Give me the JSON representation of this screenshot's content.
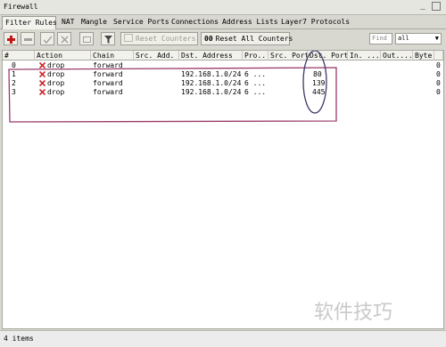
{
  "window": {
    "title": "Firewall",
    "minimize_glyph": "_",
    "maximize_glyph": ""
  },
  "tabs": [
    {
      "label": "Filter Rules",
      "active": true
    },
    {
      "label": "NAT",
      "active": false
    },
    {
      "label": "Mangle",
      "active": false
    },
    {
      "label": "Service Ports",
      "active": false
    },
    {
      "label": "Connections",
      "active": false
    },
    {
      "label": "Address Lists",
      "active": false
    },
    {
      "label": "Layer7 Protocols",
      "active": false
    }
  ],
  "toolbar": {
    "reset_counters_label": "Reset Counters",
    "reset_all_counters_label": "Reset All Counters",
    "reset_all_counters_prefix": "00",
    "find_placeholder": "Find",
    "filter_value": "all",
    "icons": [
      "plus-icon",
      "minus-icon",
      "check-icon",
      "cross-icon",
      "comment-icon",
      "filter-icon"
    ]
  },
  "table": {
    "columns": [
      "#",
      "Action",
      "Chain",
      "Src. Add.",
      "Dst. Address",
      "Pro...",
      "Src. Port",
      "Dst. Port",
      "In. ...",
      "Out....",
      "Byte",
      ""
    ],
    "rows": [
      {
        "num": "0",
        "action": "drop",
        "chain": "forward",
        "src_add": "",
        "dst_address": "",
        "proto": "",
        "src_port": "",
        "dst_port": "",
        "in": "",
        "out": "",
        "bytes": "0"
      },
      {
        "num": "1",
        "action": "drop",
        "chain": "forward",
        "src_add": "",
        "dst_address": "192.168.1.0/24",
        "proto": "6 ...",
        "src_port": "",
        "dst_port": "80",
        "in": "",
        "out": "",
        "bytes": "0"
      },
      {
        "num": "2",
        "action": "drop",
        "chain": "forward",
        "src_add": "",
        "dst_address": "192.168.1.0/24",
        "proto": "6 ...",
        "src_port": "",
        "dst_port": "139",
        "in": "",
        "out": "",
        "bytes": "0"
      },
      {
        "num": "3",
        "action": "drop",
        "chain": "forward",
        "src_add": "",
        "dst_address": "192.168.1.0/24",
        "proto": "6 ...",
        "src_port": "",
        "dst_port": "445",
        "in": "",
        "out": "",
        "bytes": "0"
      }
    ]
  },
  "status": {
    "items_text": "4 items"
  },
  "watermark": {
    "text": "软件技巧"
  },
  "colors": {
    "drop_icon": "#cc2222",
    "annotation": "#9a3a6a",
    "annotation_dark": "#3a3a6a"
  }
}
